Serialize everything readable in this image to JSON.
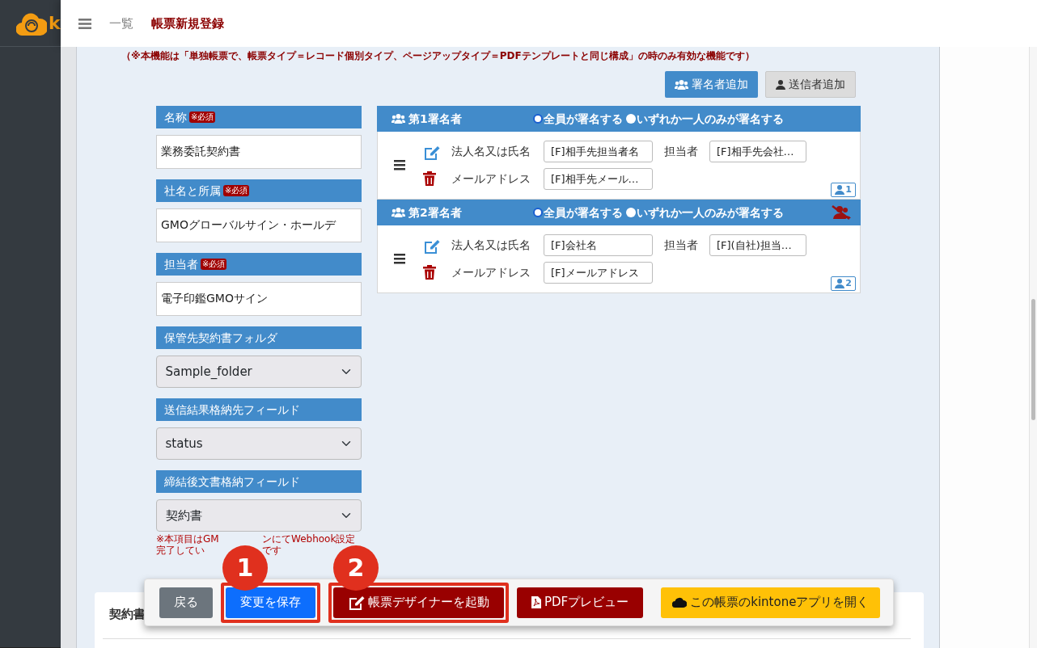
{
  "sidebar": {
    "logo_text": "k"
  },
  "topbar": {
    "breadcrumbs": [
      {
        "label": "一覧",
        "current": false
      },
      {
        "label": "帳票新規登録",
        "current": true
      }
    ]
  },
  "notice": "（※本機能は「単独帳票で、帳票タイプ＝レコード個別タイプ、ページアップタイプ＝PDFテンプレートと同じ構成」の時のみ有効な機能です）",
  "add_buttons": [
    {
      "label": "署名者追加",
      "kind": "primary"
    },
    {
      "label": "送信者追加",
      "kind": "secondary"
    }
  ],
  "form_fields": [
    {
      "label": "名称",
      "badge": "※必須",
      "kind": "text",
      "value": "業務委託契約書"
    },
    {
      "label": "社名と所属",
      "badge": "※必須",
      "kind": "text",
      "value": "GMOグローバルサイン・ホールデ"
    },
    {
      "label": "担当者",
      "badge": "※必須",
      "kind": "text",
      "value": "電子印鑑GMOサイン"
    },
    {
      "label": "保管先契約書フォルダ",
      "kind": "select",
      "value": "Sample_folder"
    },
    {
      "label": "送信結果格納先フィールド",
      "kind": "select",
      "value": "status"
    },
    {
      "label": "締結後文書格納フィールド",
      "kind": "select",
      "value": "契約書"
    }
  ],
  "field_note": [
    [
      "※本項目はGM",
      "ンにてWebhook設定"
    ],
    [
      "完了してい",
      "です"
    ]
  ],
  "signers": [
    {
      "title": "第1署名者",
      "options": [
        {
          "label": "全員が署名する",
          "selected": true
        },
        {
          "label": "いずれか一人のみが署名する",
          "selected": false
        }
      ],
      "removable": false,
      "order": "1",
      "fields": [
        {
          "label": "法人名又は氏名",
          "value": "[F]相手先担当者名"
        },
        {
          "label": "担当者",
          "value": "[F]相手先会社…"
        },
        {
          "label": "メールアドレス",
          "value": "[F]相手先メール…"
        }
      ]
    },
    {
      "title": "第2署名者",
      "options": [
        {
          "label": "全員が署名する",
          "selected": true
        },
        {
          "label": "いずれか一人のみが署名する",
          "selected": false
        }
      ],
      "removable": true,
      "order": "2",
      "fields": [
        {
          "label": "法人名又は氏名",
          "value": "[F]会社名"
        },
        {
          "label": "担当者",
          "value": "[F](自社)担当…"
        },
        {
          "label": "メールアドレス",
          "value": "[F]メールアドレス"
        }
      ]
    }
  ],
  "card_title": "契約書",
  "footer": {
    "buttons": [
      {
        "label": "戻る",
        "kind": "back"
      },
      {
        "label": "変更を保存",
        "kind": "save",
        "callout": "1"
      },
      {
        "label": "帳票デザイナーを起動",
        "kind": "designer",
        "callout": "2"
      },
      {
        "label": "PDFプレビュー",
        "kind": "pdf"
      },
      {
        "label": "この帳票のkintoneアプリを開く",
        "kind": "kintone"
      }
    ]
  }
}
